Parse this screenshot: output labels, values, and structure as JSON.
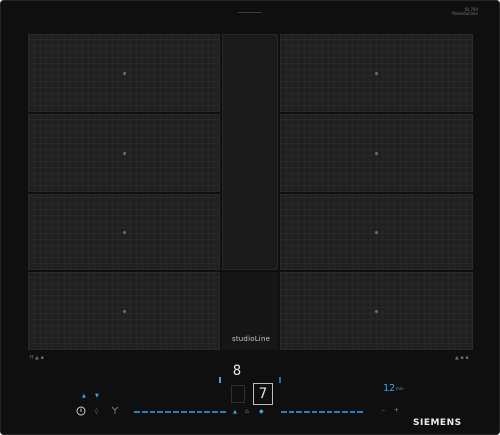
{
  "appliance": {
    "series_label": "studioLine",
    "brand": "SIEMENS",
    "top_label_line1": "IQ 700",
    "top_label_line2": "flexInduction",
    "mark_left": "ﬀ ▲ ▪",
    "mark_right": "▲ ▪ ▪"
  },
  "controls": {
    "power_icon": "power-icon",
    "left_up_arrow": "▲",
    "left_down_arrow": "▼",
    "left_glyph": "⌂",
    "center_digit_top": "8",
    "center_digit_active": "7",
    "center_glyph_left": "▲",
    "center_glyph_right": "⌂",
    "timer_value": "12",
    "timer_unit": "min"
  },
  "colors": {
    "hob_black": "#0f0f0f",
    "zone_dark": "#202020",
    "accent_blue": "#3aa7e8",
    "display_white": "#e6e6e6"
  }
}
